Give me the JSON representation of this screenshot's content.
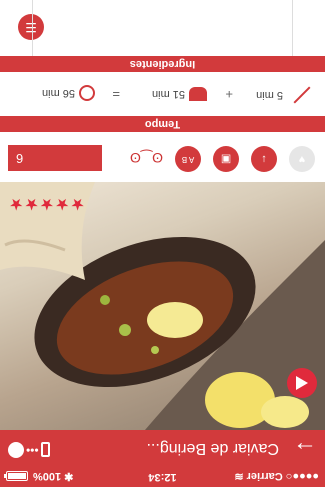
{
  "statusbar": {
    "carrier": "●●●●○ Carrier",
    "wifi": "≋",
    "time": "12:34",
    "bluetooth": "✱",
    "battery": "100%"
  },
  "header": {
    "back_glyph": "→",
    "title": "Caviar de Bering...",
    "dots": "•••"
  },
  "rating": {
    "stars": "★★★★★",
    "value": 5,
    "max": 5
  },
  "controls": {
    "btn_down": "↓",
    "btn_doc": "▣",
    "btn_ab": "A B",
    "portions": "6"
  },
  "tempo": {
    "label": "Tempo",
    "prep": "5 min",
    "cook": "51 min",
    "total": "56 min",
    "plus": "+",
    "equals": "="
  },
  "ingredients": {
    "label": "Ingredientes"
  },
  "colors": {
    "brand": "#d23a3c",
    "accent": "#e02a3c"
  }
}
